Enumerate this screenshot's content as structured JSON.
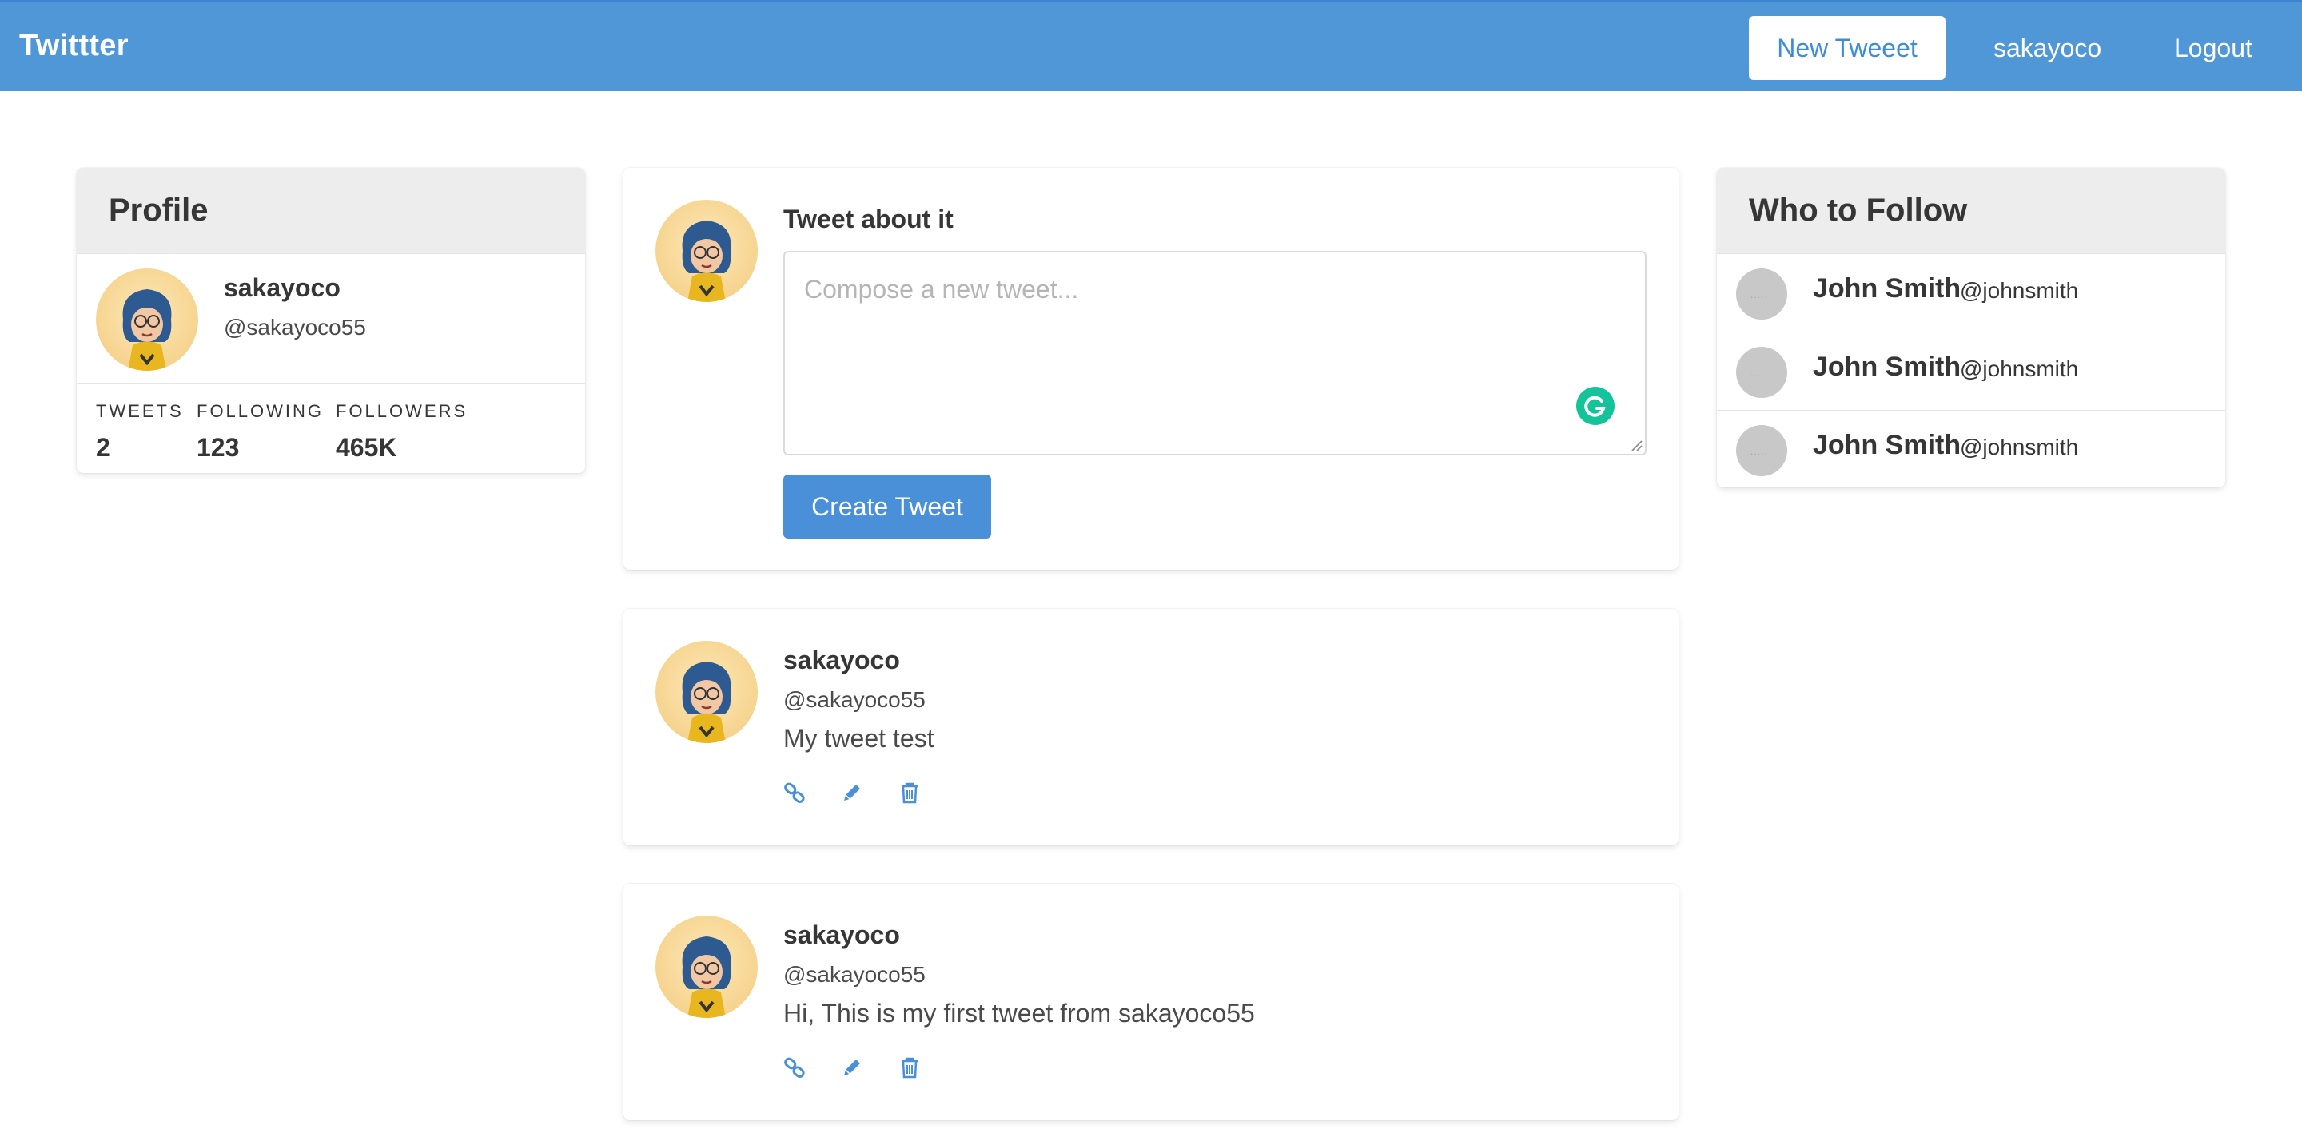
{
  "nav": {
    "brand": "Twittter",
    "new_tweet_label": "New Tweeet",
    "user_label": "sakayoco",
    "logout_label": "Logout"
  },
  "profile": {
    "header": "Profile",
    "name": "sakayoco",
    "handle": "@sakayoco55",
    "stats": [
      {
        "label": "TWEETS",
        "value": "2"
      },
      {
        "label": "FOLLOWING",
        "value": "123"
      },
      {
        "label": "FOLLOWERS",
        "value": "465K"
      }
    ]
  },
  "compose": {
    "title": "Tweet about it",
    "placeholder": "Compose a new tweet...",
    "button_label": "Create Tweet"
  },
  "tweets": [
    {
      "name": "sakayoco",
      "handle": "@sakayoco55",
      "text": "My tweet test"
    },
    {
      "name": "sakayoco",
      "handle": "@sakayoco55",
      "text": "Hi, This is my first tweet from sakayoco55"
    }
  ],
  "follow": {
    "header": "Who to Follow",
    "users": [
      {
        "name": "John Smith",
        "handle": "@johnsmith"
      },
      {
        "name": "John Smith",
        "handle": "@johnsmith"
      },
      {
        "name": "John Smith",
        "handle": "@johnsmith"
      }
    ]
  },
  "colors": {
    "navbar": "#5097d8",
    "accent": "#4a90d9",
    "grammarly": "#15c39a"
  },
  "icons": [
    "link-icon",
    "pencil-icon",
    "trash-icon",
    "grammarly-icon",
    "resize-grip-icon",
    "avatar-image"
  ]
}
